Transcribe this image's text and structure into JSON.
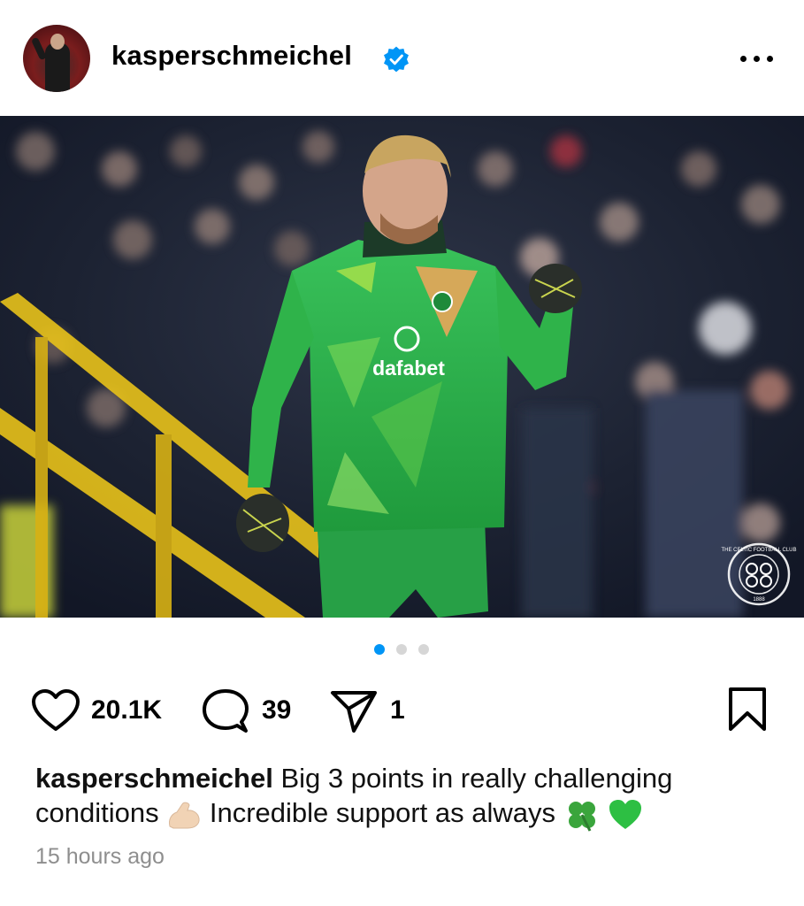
{
  "post": {
    "username": "kasperschmeichel",
    "verified": true,
    "more_icon": "more-horizontal-icon",
    "photo_overlay_logo_text": [
      "THE CELTIC FOOTBALL CLUB",
      "1888"
    ],
    "jersey_sponsor": "dafabet",
    "carousel": {
      "total": 3,
      "active": 1
    },
    "likes": "20.1K",
    "comments": "39",
    "shares": "1",
    "caption_user": "kasperschmeichel",
    "caption_line1": "Big 3 points in really challenging",
    "caption_line2_a": "conditions",
    "caption_line2_b": "Incredible support as always",
    "time": "15 hours ago"
  },
  "icons": {
    "like": "heart-icon",
    "comment": "comment-icon",
    "share": "send-icon",
    "save": "bookmark-icon",
    "verified": "verified-badge-icon",
    "emojis": [
      "flexed-biceps-emoji",
      "four-leaf-clover-emoji",
      "green-heart-emoji"
    ]
  },
  "colors": {
    "verified_blue": "#0095f6",
    "active_dot": "#0095f6",
    "inactive_dot": "#d6d6d6",
    "timestamp": "#8e8e8e",
    "kit_green": "#2fb34a"
  }
}
